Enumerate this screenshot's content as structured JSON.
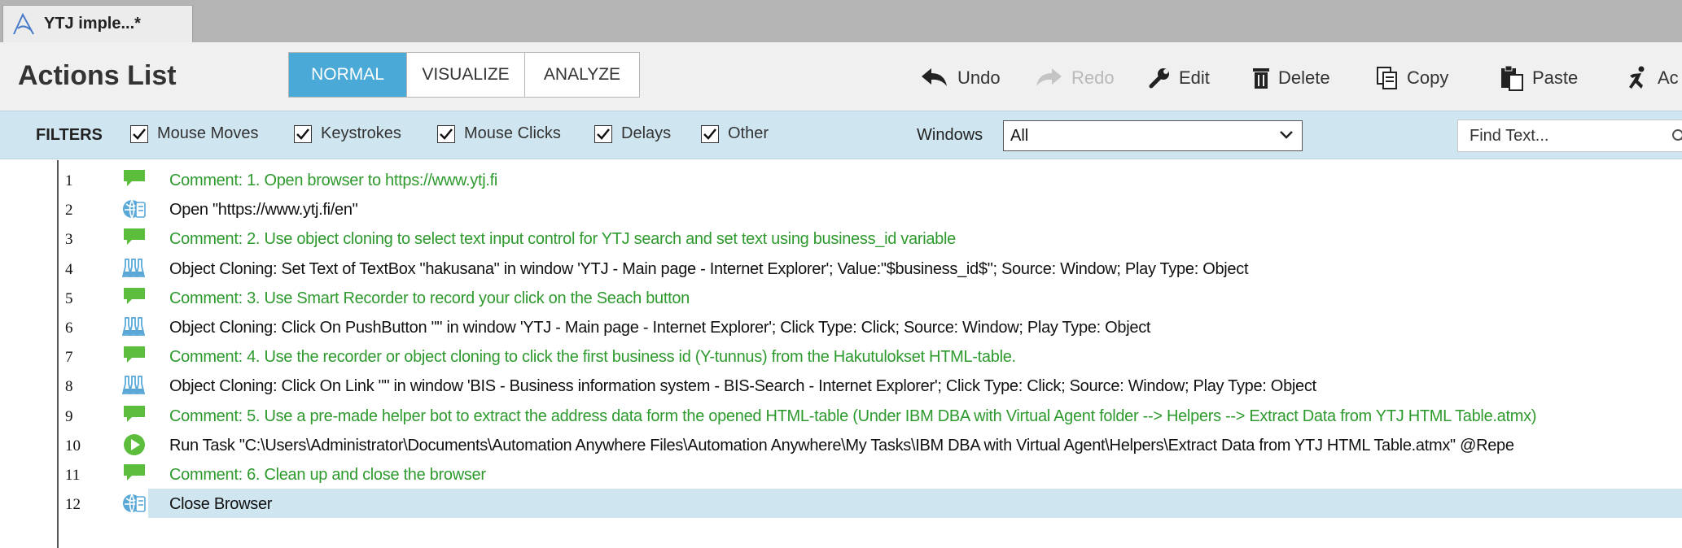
{
  "tab": {
    "label": "YTJ imple...*"
  },
  "header": {
    "title": "Actions List",
    "modes": [
      {
        "label": "NORMAL",
        "active": true
      },
      {
        "label": "VISUALIZE",
        "active": false
      },
      {
        "label": "ANALYZE",
        "active": false
      }
    ]
  },
  "toolbar": {
    "undo": "Undo",
    "redo": "Redo",
    "edit": "Edit",
    "delete": "Delete",
    "copy": "Copy",
    "paste": "Paste",
    "act": "Ac"
  },
  "filters": {
    "label": "FILTERS",
    "items": [
      {
        "label": "Mouse Moves",
        "checked": true
      },
      {
        "label": "Keystrokes",
        "checked": true
      },
      {
        "label": "Mouse Clicks",
        "checked": true
      },
      {
        "label": "Delays",
        "checked": true
      },
      {
        "label": "Other",
        "checked": true
      }
    ],
    "windows_label": "Windows",
    "windows_value": "All",
    "find_placeholder": "Find Text..."
  },
  "colors": {
    "accent": "#4aa9d6",
    "comment_text": "#2e9a2e",
    "filter_bg": "#cfe6f1",
    "selected_row": "#cfe6f1"
  },
  "actions": [
    {
      "num": "1",
      "icon": "comment-icon",
      "type": "comment",
      "text": "Comment: 1. Open browser to https://www.ytj.fi"
    },
    {
      "num": "2",
      "icon": "web-browser-icon",
      "type": "action",
      "text": "Open \"https://www.ytj.fi/en\""
    },
    {
      "num": "3",
      "icon": "comment-icon",
      "type": "comment",
      "text": "Comment: 2. Use object cloning to select text input control for YTJ search and set text using business_id variable"
    },
    {
      "num": "4",
      "icon": "object-cloning-icon",
      "type": "action",
      "text": "Object Cloning: Set Text of TextBox \"hakusana\" in window 'YTJ - Main page - Internet Explorer'; Value:\"$business_id$\"; Source: Window; Play Type: Object"
    },
    {
      "num": "5",
      "icon": "comment-icon",
      "type": "comment",
      "text": "Comment: 3. Use Smart Recorder to record your click on the Seach button"
    },
    {
      "num": "6",
      "icon": "object-cloning-icon",
      "type": "action",
      "text": "Object Cloning: Click On PushButton \"\" in window 'YTJ - Main page - Internet Explorer'; Click Type: Click; Source: Window; Play Type: Object"
    },
    {
      "num": "7",
      "icon": "comment-icon",
      "type": "comment",
      "text": "Comment: 4. Use the recorder or object cloning to click the first business id (Y-tunnus) from the Hakutulokset HTML-table."
    },
    {
      "num": "8",
      "icon": "object-cloning-icon",
      "type": "action",
      "text": "Object Cloning: Click On Link \"\" in window 'BIS - Business information system - BIS-Search - Internet Explorer'; Click Type: Click; Source: Window; Play Type: Object"
    },
    {
      "num": "9",
      "icon": "comment-icon",
      "type": "comment",
      "text": "Comment: 5. Use a pre-made helper bot to extract the address data form the opened HTML-table (Under IBM DBA with Virtual Agent folder --> Helpers --> Extract Data from YTJ HTML Table.atmx)"
    },
    {
      "num": "10",
      "icon": "run-task-icon",
      "type": "action",
      "text": "Run Task \"C:\\Users\\Administrator\\Documents\\Automation Anywhere Files\\Automation Anywhere\\My Tasks\\IBM DBA with Virtual Agent\\Helpers\\Extract Data from YTJ HTML Table.atmx\" @Repe"
    },
    {
      "num": "11",
      "icon": "comment-icon",
      "type": "comment",
      "text": "Comment: 6. Clean up and close the browser"
    },
    {
      "num": "12",
      "icon": "web-browser-icon",
      "type": "action",
      "text": "Close Browser",
      "selected": true
    }
  ]
}
